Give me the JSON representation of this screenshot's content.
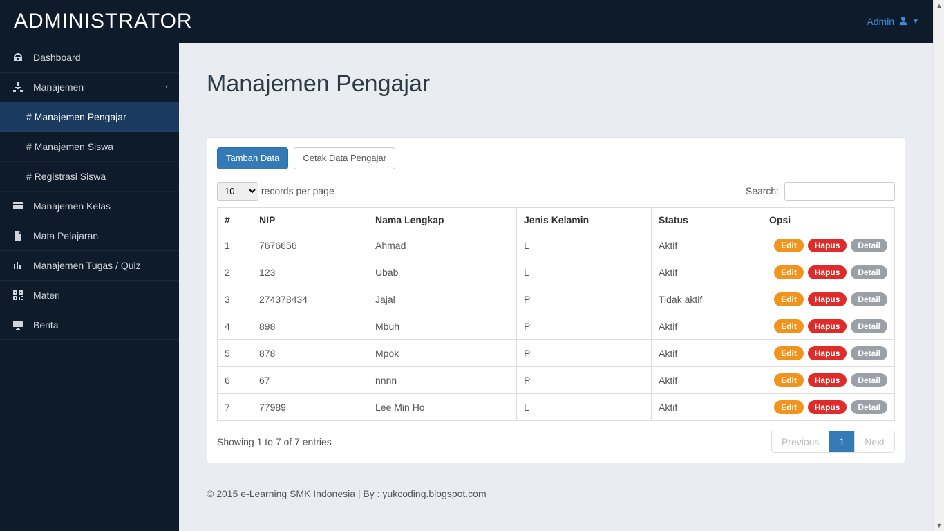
{
  "header": {
    "brand": "ADMINISTRATOR",
    "user_label": "Admin"
  },
  "sidebar": {
    "items": [
      {
        "label": "Dashboard",
        "icon": "dashboard"
      },
      {
        "label": "Manajemen",
        "icon": "sitemap",
        "expanded": true,
        "children": [
          {
            "label": "# Manajemen Pengajar",
            "active": true
          },
          {
            "label": "# Manajemen Siswa"
          },
          {
            "label": "# Registrasi Siswa"
          }
        ]
      },
      {
        "label": "Manajemen Kelas",
        "icon": "grid"
      },
      {
        "label": "Mata Pelajaran",
        "icon": "file"
      },
      {
        "label": "Manajemen Tugas / Quiz",
        "icon": "chart"
      },
      {
        "label": "Materi",
        "icon": "qr"
      },
      {
        "label": "Berita",
        "icon": "desktop"
      }
    ]
  },
  "page": {
    "title": "Manajemen Pengajar",
    "add_button": "Tambah Data",
    "print_button": "Cetak Data Pengajar",
    "per_page_value": "10",
    "per_page_suffix": "records per page",
    "search_label": "Search:"
  },
  "table": {
    "headers": [
      "#",
      "NIP",
      "Nama Lengkap",
      "Jenis Kelamin",
      "Status",
      "Opsi"
    ],
    "rows": [
      {
        "n": "1",
        "nip": "7676656",
        "nama": "Ahmad",
        "jk": "L",
        "status": "Aktif"
      },
      {
        "n": "2",
        "nip": "123",
        "nama": "Ubab",
        "jk": "L",
        "status": "Aktif"
      },
      {
        "n": "3",
        "nip": "274378434",
        "nama": "Jajal",
        "jk": "P",
        "status": "Tidak aktif"
      },
      {
        "n": "4",
        "nip": "898",
        "nama": "Mbuh",
        "jk": "P",
        "status": "Aktif"
      },
      {
        "n": "5",
        "nip": "878",
        "nama": "Mpok",
        "jk": "P",
        "status": "Aktif"
      },
      {
        "n": "6",
        "nip": "67",
        "nama": "nnnn",
        "jk": "P",
        "status": "Aktif"
      },
      {
        "n": "7",
        "nip": "77989",
        "nama": "Lee Min Ho",
        "jk": "L",
        "status": "Aktif"
      }
    ],
    "actions": {
      "edit": "Edit",
      "delete": "Hapus",
      "detail": "Detail"
    },
    "info": "Showing 1 to 7 of 7 entries",
    "pagination": {
      "prev": "Previous",
      "next": "Next",
      "current": "1"
    }
  },
  "footer": {
    "text": "© 2015 e-Learning SMK Indonesia | By : yukcoding.blogspot.com"
  }
}
